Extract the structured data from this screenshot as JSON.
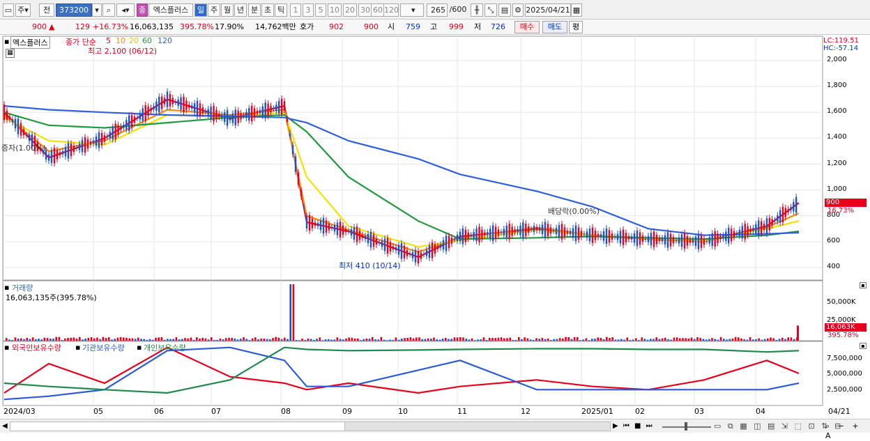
{
  "toolbar": {
    "period_button": "주",
    "prev_button": "전",
    "code_value": "373200",
    "stock_badge": "종",
    "stock_name": "엑스플러스",
    "tf_day": "일",
    "tf_week": "주",
    "tf_month": "월",
    "tf_year": "년",
    "tf_min": "분",
    "tf_sec": "초",
    "tf_tick": "틱",
    "tick_options": [
      "1",
      "3",
      "5",
      "10",
      "20",
      "30",
      "60",
      "120"
    ],
    "count_value": "265",
    "count_max": "/600",
    "date_value": "2025/04/21"
  },
  "info": {
    "price": "900",
    "change_arrow": "▲",
    "change": "129",
    "change_pct": "+16.73%",
    "volume": "16,063,135",
    "volume_pct": "395.78%",
    "turnover": "17.90%",
    "amount": "14,762백만",
    "quote_label": "호가",
    "bid": "902",
    "ask": "900",
    "open_label": "시",
    "open": "759",
    "high_label": "고",
    "high": "999",
    "low_label": "저",
    "low": "726",
    "buy_button": "매수",
    "sell_button": "매도",
    "eval_button": "평"
  },
  "price_panel": {
    "name_tag": "엑스플러스",
    "legend_title": "종가 단순",
    "ma_labels": [
      "5",
      "10",
      "20",
      "60",
      "120"
    ],
    "ma_colors": [
      "#e8001c",
      "#ff8c00",
      "#f2e200",
      "#1f9a3c",
      "#3060e0"
    ],
    "high_annotation": "최고 2,100 (06/12)",
    "low_annotation": "최저 410 (10/14)",
    "dividend_annotation": "배당락(0.00%)",
    "baseline_annotation": "증자(1.00%)",
    "lc_label": "LC:119.51",
    "hc_label": "HC:-57.14",
    "y_ticks": [
      "2,000",
      "1,800",
      "1,600",
      "1,400",
      "1,200",
      "1,000",
      "800",
      "600",
      "400"
    ],
    "current_tag_price": "900",
    "current_tag_pct": "16.73%"
  },
  "volume_panel": {
    "title": "거래량",
    "value_text": "16,063,135주(395.78%)",
    "y_ticks": [
      "50,000K",
      "25,000K"
    ],
    "current_tag": "16,063K",
    "current_tag_pct": "395.78%"
  },
  "holdings_panel": {
    "legend_foreign": "외국인보유수량",
    "legend_institution": "기관보유수량",
    "legend_individual": "개인보유수량",
    "y_ticks": [
      "7,500,000",
      "5,000,000",
      "2,500,000"
    ]
  },
  "x_axis": {
    "labels": [
      "2024/03",
      "05",
      "06",
      "07",
      "08",
      "09",
      "10",
      "11",
      "12",
      "2025/01",
      "02",
      "03",
      "04"
    ],
    "last_label": "04/21"
  },
  "chart_data": [
    {
      "type": "line",
      "title": "",
      "note": "price panel (candles approximated by close line) with moving averages",
      "x": [
        "2024/03",
        "2024/04",
        "2024/05",
        "2024/06",
        "2024/07",
        "2024/08 early",
        "2024/08 mid",
        "2024/09",
        "2024/10",
        "2024/11",
        "2024/12",
        "2025/01",
        "2025/02",
        "2025/03",
        "2025/04",
        "2025/04/21"
      ],
      "series": [
        {
          "name": "5",
          "values": [
            1600,
            1250,
            1400,
            1700,
            1550,
            1650,
            750,
            680,
            480,
            640,
            700,
            650,
            620,
            600,
            720,
            900
          ]
        },
        {
          "name": "10",
          "values": [
            1580,
            1300,
            1380,
            1620,
            1580,
            1620,
            800,
            690,
            520,
            630,
            710,
            650,
            620,
            600,
            710,
            820
          ]
        },
        {
          "name": "20",
          "values": [
            1560,
            1380,
            1350,
            1580,
            1560,
            1600,
            1100,
            720,
            560,
            610,
            690,
            650,
            625,
            605,
            700,
            760
          ]
        },
        {
          "name": "60",
          "values": [
            1600,
            1500,
            1480,
            1520,
            1560,
            1580,
            1450,
            1100,
            760,
            620,
            630,
            640,
            630,
            620,
            650,
            680
          ]
        },
        {
          "name": "120",
          "values": [
            1650,
            1620,
            1600,
            1580,
            1570,
            1560,
            1520,
            1380,
            1240,
            1120,
            990,
            870,
            700,
            650,
            660,
            670
          ]
        }
      ],
      "ylim": [
        350,
        2120
      ]
    },
    {
      "type": "bar",
      "title": "거래량",
      "note": "daily volume, approximate (K shares)",
      "peak_value": 60000,
      "last_value": 16063,
      "ylim": [
        0,
        60000
      ]
    },
    {
      "type": "line",
      "title": "보유수량",
      "series": [
        {
          "name": "외국인보유수량",
          "values": [
            1500000,
            6000000,
            3000000,
            8500000,
            4000000,
            3000000,
            2000000,
            3000000,
            1500000,
            2500000,
            3500000,
            2500000,
            2000000,
            3500000,
            6500000,
            4500000
          ]
        },
        {
          "name": "기관보유수량",
          "values": [
            500000,
            1000000,
            2000000,
            8000000,
            8500000,
            6500000,
            2500000,
            2500000,
            5000000,
            6500000,
            2000000,
            2000000,
            2000000,
            2000000,
            2000000,
            3000000
          ]
        },
        {
          "name": "개인보유수량",
          "values": [
            3000000,
            2500000,
            2000000,
            1500000,
            3500000,
            8500000,
            8200000,
            8000000,
            8100000,
            8200000,
            8300000,
            8300000,
            8200000,
            8200000,
            7800000,
            8000000
          ]
        }
      ],
      "ylim": [
        0,
        9000000
      ]
    }
  ]
}
